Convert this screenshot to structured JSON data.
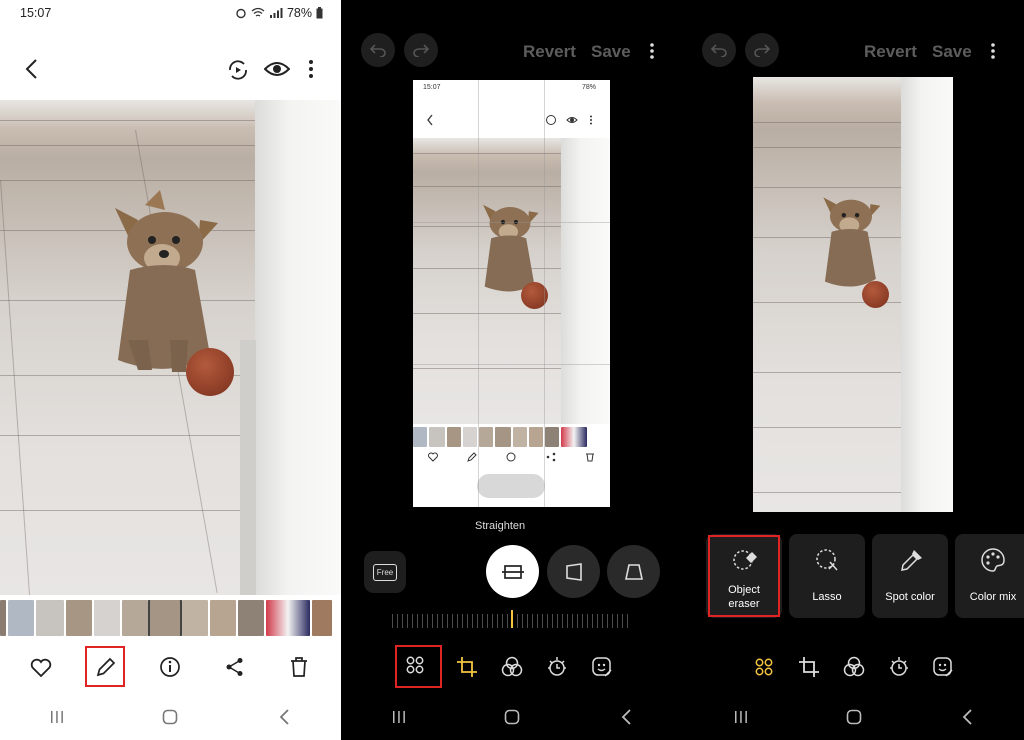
{
  "panel1": {
    "status": {
      "time": "15:07",
      "battery": "78%"
    },
    "icons": {
      "back": "arrow-left-icon",
      "remaster": "remaster-icon",
      "eye": "eye-icon",
      "more": "more-vertical-icon"
    },
    "actions": [
      "heart-icon",
      "pencil-icon",
      "info-icon",
      "share-icon",
      "trash-icon"
    ]
  },
  "panel2": {
    "toolbar": {
      "revert": "Revert",
      "save": "Save"
    },
    "mini_preview": {
      "time": "15:07",
      "battery": "78%"
    },
    "straighten_label": "Straighten",
    "free_label": "Free",
    "tabs": [
      "tools-grid-icon",
      "crop-rotate-icon",
      "filters-icon",
      "tone-icon",
      "decorations-icon"
    ]
  },
  "panel3": {
    "toolbar": {
      "revert": "Revert",
      "save": "Save"
    },
    "tools": [
      {
        "label_line1": "Object",
        "label_line2": "eraser"
      },
      {
        "label": "Lasso"
      },
      {
        "label": "Spot color"
      },
      {
        "label": "Color mix"
      }
    ]
  },
  "colors": {
    "accent_yellow": "#f5c542",
    "highlight_red": "#e02424"
  }
}
